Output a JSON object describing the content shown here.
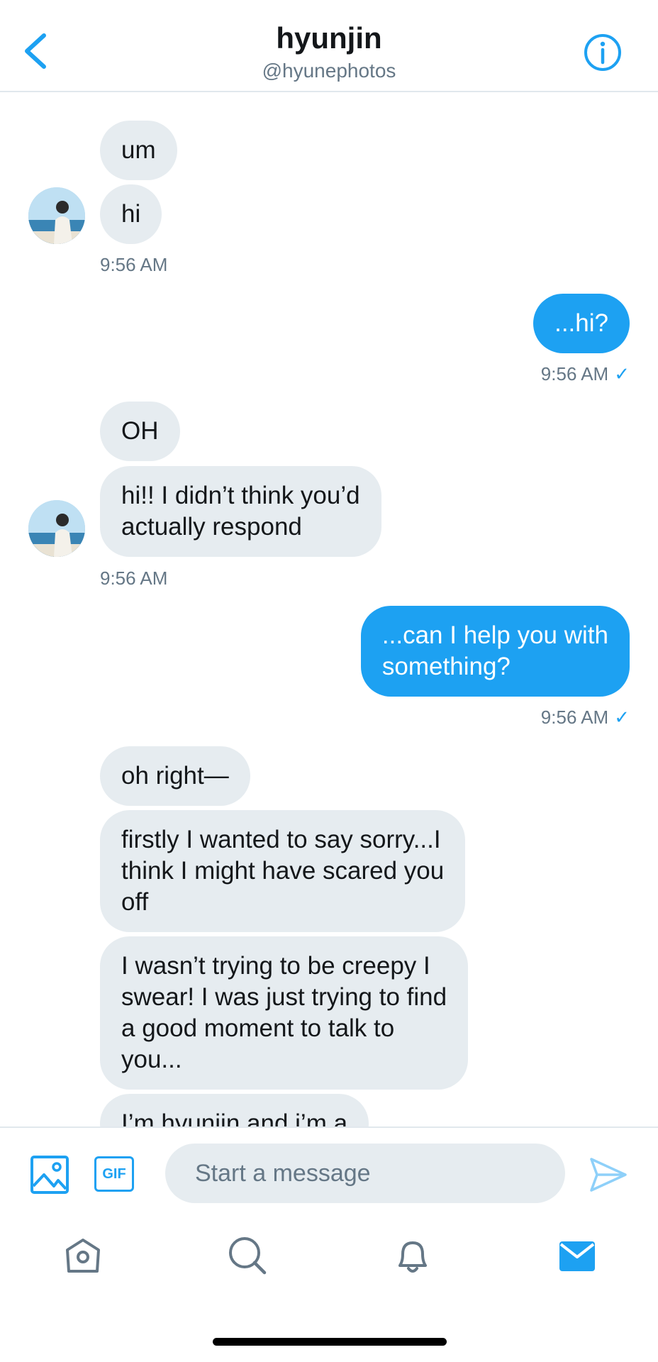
{
  "header": {
    "name": "hyunjin",
    "handle": "@hyunephotos",
    "back_icon": "chevron-left-icon",
    "info_icon": "info-icon"
  },
  "messages": [
    {
      "from": "them",
      "text": "um"
    },
    {
      "from": "them",
      "text": "hi"
    },
    {
      "time": "9:56 AM",
      "side": "them"
    },
    {
      "from": "me",
      "text": "...hi?"
    },
    {
      "time": "9:56 AM",
      "side": "me",
      "read": "✓"
    },
    {
      "from": "them",
      "text": "OH"
    },
    {
      "from": "them",
      "text": "hi!! I didn’t think you’d\nactually respond"
    },
    {
      "time": "9:56 AM",
      "side": "them"
    },
    {
      "from": "me",
      "text": "...can I help you with\nsomething?"
    },
    {
      "time": "9:56 AM",
      "side": "me",
      "read": "✓"
    },
    {
      "from": "them",
      "text": "oh right—"
    },
    {
      "from": "them",
      "text": "firstly I wanted to say sorry...I\nthink I might have scared you\noff"
    },
    {
      "from": "them",
      "text": "I wasn’t trying to be creepy I\nswear! I was just trying to find\na good moment to talk to\nyou..."
    },
    {
      "from": "them",
      "text": "I’m hyunjin and i’m a"
    }
  ],
  "composer": {
    "placeholder": "Start a message",
    "gif_label": "GIF",
    "media_icon": "image-icon",
    "send_icon": "send-icon"
  },
  "tabs": [
    {
      "name": "home",
      "icon": "home-icon"
    },
    {
      "name": "search",
      "icon": "search-icon"
    },
    {
      "name": "notifications",
      "icon": "bell-icon"
    },
    {
      "name": "messages",
      "icon": "mail-icon",
      "active": true
    }
  ],
  "colors": {
    "accent": "#1da1f2",
    "incoming_bubble": "#e6ecf0",
    "muted_text": "#657786"
  }
}
